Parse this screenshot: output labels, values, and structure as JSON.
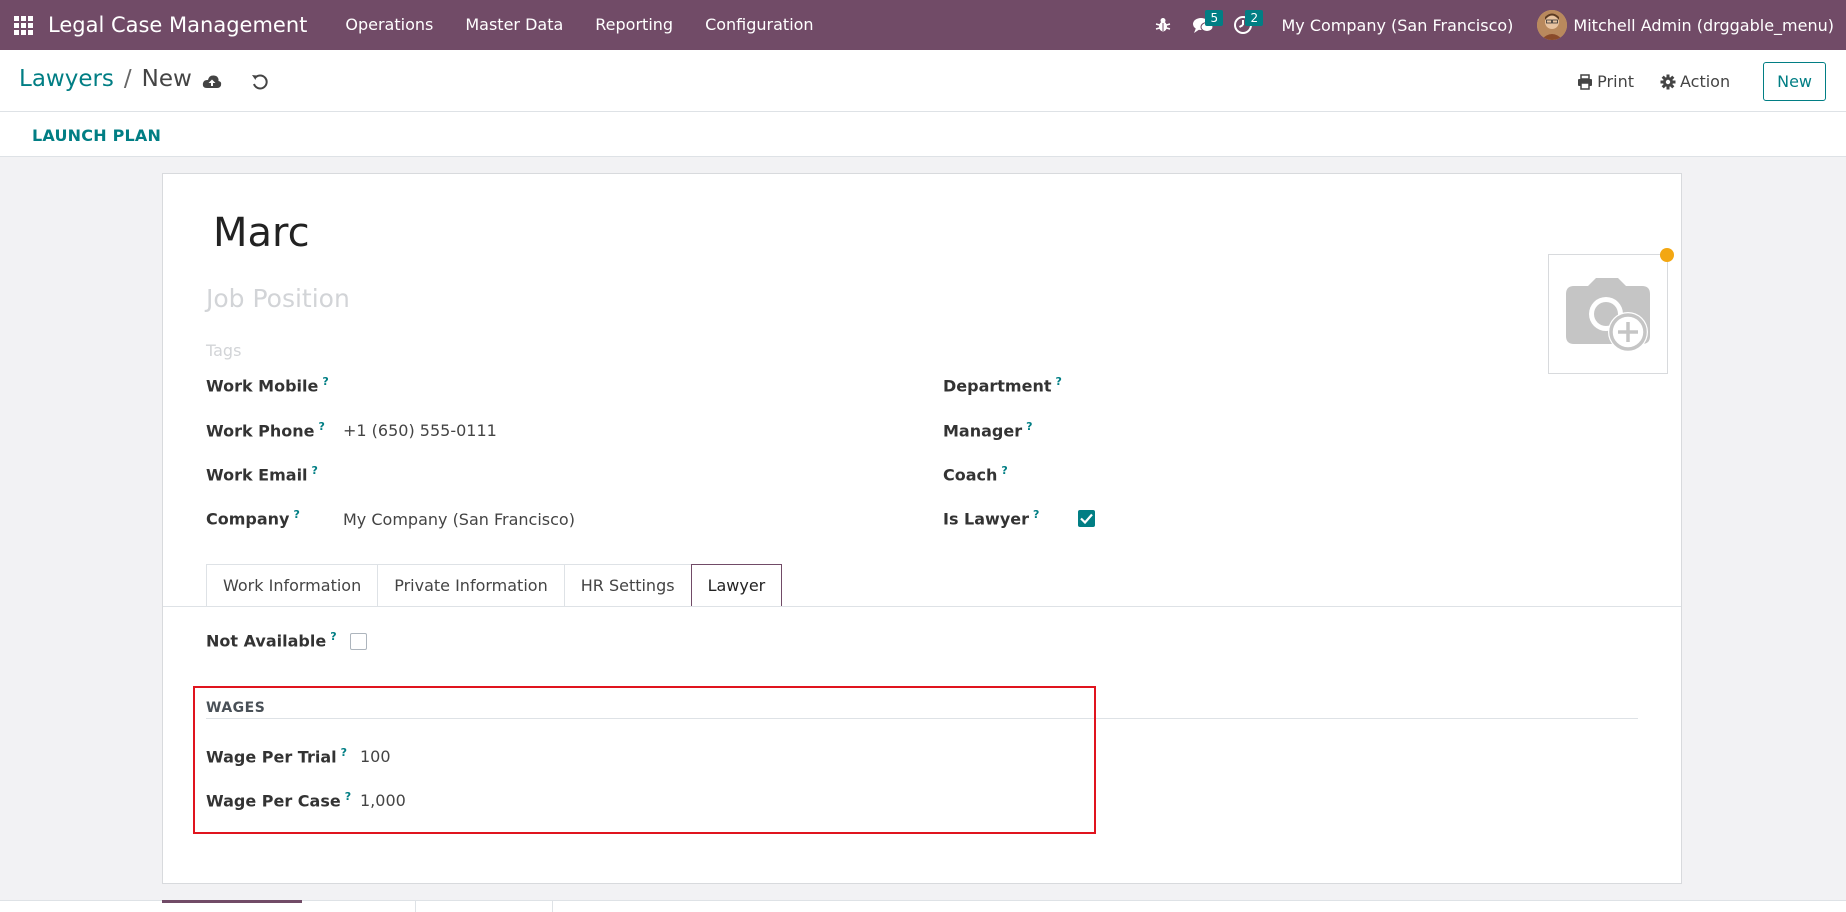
{
  "navbar": {
    "app_title": "Legal Case Management",
    "menu": [
      "Operations",
      "Master Data",
      "Reporting",
      "Configuration"
    ],
    "messages_count": "5",
    "activities_count": "2",
    "company": "My Company (San Francisco)",
    "user": "Mitchell Admin (drggable_menu)"
  },
  "control_panel": {
    "breadcrumb_parent": "Lawyers",
    "breadcrumb_separator": "/",
    "breadcrumb_current": "New",
    "print_label": "Print",
    "action_label": "Action",
    "new_label": "New"
  },
  "statusbar": {
    "launch_plan_label": "LAUNCH PLAN"
  },
  "form": {
    "name": "Marc",
    "job_position_placeholder": "Job Position",
    "tags_placeholder": "Tags",
    "left_fields": {
      "work_mobile": {
        "label": "Work Mobile",
        "value": ""
      },
      "work_phone": {
        "label": "Work Phone",
        "value": "+1 (650) 555-0111"
      },
      "work_email": {
        "label": "Work Email",
        "value": ""
      },
      "company": {
        "label": "Company",
        "value": "My Company (San Francisco)"
      }
    },
    "right_fields": {
      "department": {
        "label": "Department",
        "value": ""
      },
      "manager": {
        "label": "Manager",
        "value": ""
      },
      "coach": {
        "label": "Coach",
        "value": ""
      },
      "is_lawyer": {
        "label": "Is Lawyer",
        "checked": true
      }
    },
    "help_mark": "?",
    "tabs": [
      "Work Information",
      "Private Information",
      "HR Settings",
      "Lawyer"
    ],
    "active_tab": "Lawyer",
    "lawyer_tab": {
      "not_available": {
        "label": "Not Available",
        "checked": false
      },
      "wages_section_title": "WAGES",
      "wage_per_trial": {
        "label": "Wage Per Trial",
        "value": "100"
      },
      "wage_per_case": {
        "label": "Wage Per Case",
        "value": "1,000"
      }
    }
  },
  "colors": {
    "brand": "#714b67",
    "accent": "#017e84",
    "highlight": "#e0141e",
    "notification_dot": "#f3a712"
  },
  "icons": {
    "apps": "apps-grid-icon",
    "debug": "bug-icon",
    "messages": "chat-bubbles-icon",
    "activities": "clock-icon",
    "save": "cloud-upload-icon",
    "discard": "undo-icon",
    "print": "printer-icon",
    "action": "gear-icon",
    "photo": "camera-plus-icon"
  }
}
